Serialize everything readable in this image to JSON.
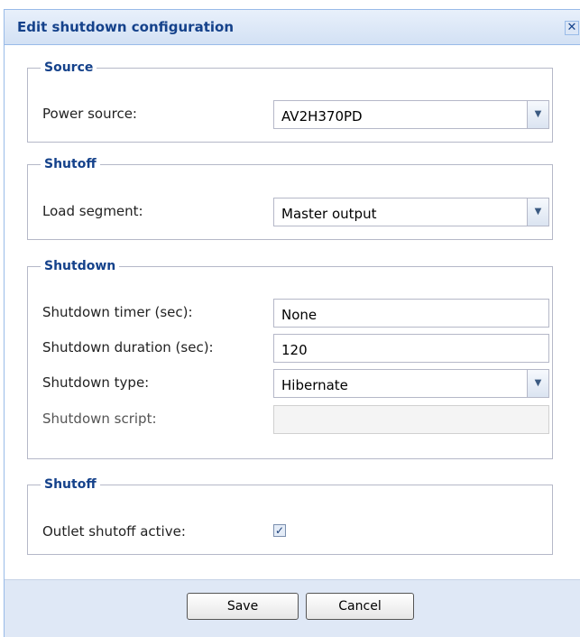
{
  "dialog": {
    "title": "Edit shutdown configuration",
    "close_glyph": "✕"
  },
  "sections": {
    "source": {
      "legend": "Source",
      "power_source_label": "Power source:",
      "power_source_value": "AV2H370PD"
    },
    "shutoff_segment": {
      "legend": "Shutoff",
      "load_segment_label": "Load segment:",
      "load_segment_value": "Master output"
    },
    "shutdown": {
      "legend": "Shutdown",
      "timer_label": "Shutdown timer (sec):",
      "timer_value": "None",
      "duration_label": "Shutdown duration (sec):",
      "duration_value": "120",
      "type_label": "Shutdown type:",
      "type_value": "Hibernate",
      "script_label": "Shutdown script:",
      "script_value": ""
    },
    "shutoff_outlet": {
      "legend": "Shutoff",
      "outlet_label": "Outlet shutoff active:",
      "outlet_checked": true,
      "check_glyph": "✓"
    }
  },
  "buttons": {
    "save": "Save",
    "cancel": "Cancel"
  },
  "icons": {
    "dropdown": "chevron-down-icon",
    "close": "close-icon",
    "checkbox": "checkmark-icon"
  },
  "colors": {
    "header_text": "#15428b",
    "footer_bg": "#dfe8f6",
    "border": "#b5b8c8"
  }
}
